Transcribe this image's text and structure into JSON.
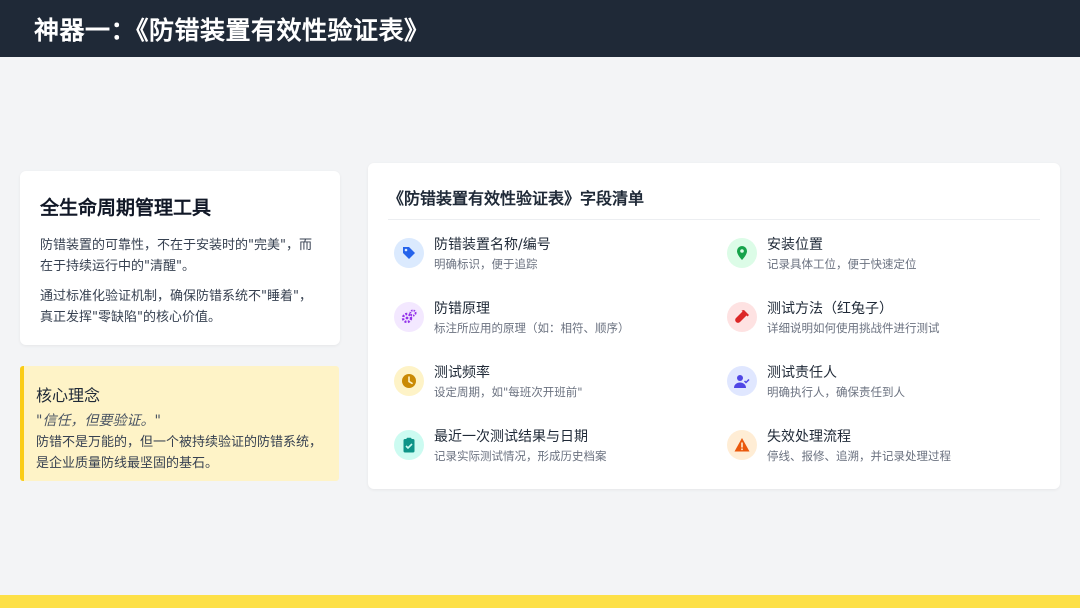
{
  "header": {
    "title": "神器一：《防错装置有效性验证表》"
  },
  "left_card": {
    "title": "全生命周期管理工具",
    "para1": "防错装置的可靠性，不在于安装时的\"完美\"，而在于持续运行中的\"清醒\"。",
    "para2": "通过标准化验证机制，确保防错系统不\"睡着\"，真正发挥\"零缺陷\"的核心价值。"
  },
  "quote_box": {
    "title": "核心理念",
    "quote": "\"信任，但要验证。\"",
    "body": "防错不是万能的，但一个被持续验证的防错系统，是企业质量防线最坚固的基石。"
  },
  "right_card": {
    "title": "《防错装置有效性验证表》字段清单",
    "fields": [
      {
        "icon": "tag-icon",
        "color": "#2563eb",
        "bg": "#dbeafe",
        "title": "防错装置名称/编号",
        "desc": "明确标识，便于追踪"
      },
      {
        "icon": "location-pin-icon",
        "color": "#16a34a",
        "bg": "#dcfce7",
        "title": "安装位置",
        "desc": "记录具体工位，便于快速定位"
      },
      {
        "icon": "gears-icon",
        "color": "#9333ea",
        "bg": "#f3e8ff",
        "title": "防错原理",
        "desc": "标注所应用的原理（如：相符、顺序）"
      },
      {
        "icon": "test-tube-icon",
        "color": "#dc2626",
        "bg": "#fee2e2",
        "title": "测试方法（红兔子）",
        "desc": "详细说明如何使用挑战件进行测试"
      },
      {
        "icon": "clock-icon",
        "color": "#ca8a04",
        "bg": "#fef3c7",
        "title": "测试频率",
        "desc": "设定周期，如\"每班次开班前\""
      },
      {
        "icon": "user-check-icon",
        "color": "#4f46e5",
        "bg": "#e0e7ff",
        "title": "测试责任人",
        "desc": "明确执行人，确保责任到人"
      },
      {
        "icon": "clipboard-check-icon",
        "color": "#0d9488",
        "bg": "#ccfbf1",
        "title": "最近一次测试结果与日期",
        "desc": "记录实际测试情况，形成历史档案"
      },
      {
        "icon": "warning-icon",
        "color": "#ea580c",
        "bg": "#ffedd5",
        "title": "失效处理流程",
        "desc": "停线、报修、追溯，并记录处理过程"
      }
    ]
  }
}
